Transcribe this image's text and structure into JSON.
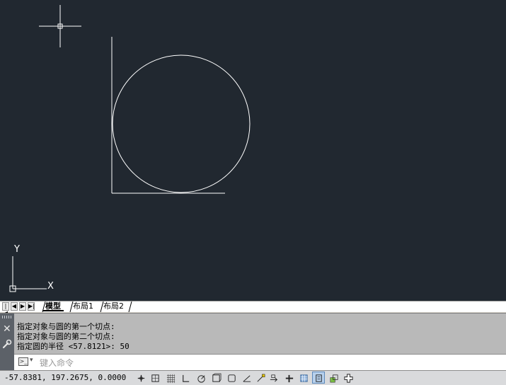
{
  "tabs": {
    "nav": [
      "|◀",
      "◀",
      "▶",
      "▶|"
    ],
    "items": [
      {
        "label": "模型",
        "active": true
      },
      {
        "label": "布局1",
        "active": false
      },
      {
        "label": "布局2",
        "active": false
      }
    ]
  },
  "command": {
    "history": [
      "指定对象与圆的第一个切点:",
      "指定对象与圆的第二个切点:",
      "指定圆的半径 <57.8121>: 50"
    ],
    "placeholder": "键入命令",
    "close_glyph": "✕",
    "prompt_glyph": ">_",
    "dropdown_glyph": "▾"
  },
  "status": {
    "coordinates": "-57.8381, 197.2675, 0.0000",
    "buttons": [
      {
        "name": "infer-constraints-icon",
        "on": false
      },
      {
        "name": "snap-mode-icon",
        "on": false
      },
      {
        "name": "grid-display-icon",
        "on": false
      },
      {
        "name": "ortho-mode-icon",
        "on": false
      },
      {
        "name": "polar-tracking-icon",
        "on": false
      },
      {
        "name": "3d-object-snap-icon",
        "on": false
      },
      {
        "name": "object-snap-icon",
        "on": false
      },
      {
        "name": "object-snap-tracking-icon",
        "on": false
      },
      {
        "name": "dynamic-ucs-icon",
        "on": false
      },
      {
        "name": "dynamic-input-icon",
        "on": false
      },
      {
        "name": "lineweight-icon",
        "on": false
      },
      {
        "name": "transparency-icon",
        "on": false
      },
      {
        "name": "quick-properties-icon",
        "on": true
      },
      {
        "name": "selection-cycling-icon",
        "on": false
      },
      {
        "name": "annotation-monitor-icon",
        "on": false
      },
      {
        "name": "workspace-switching-icon",
        "on": false
      }
    ]
  },
  "ucs": {
    "x_label": "X",
    "y_label": "Y"
  },
  "colors": {
    "canvas": "#212830",
    "entity": "#ffffff",
    "crosshair": "#ffffff",
    "active_toggle": "#b7d0ec"
  }
}
